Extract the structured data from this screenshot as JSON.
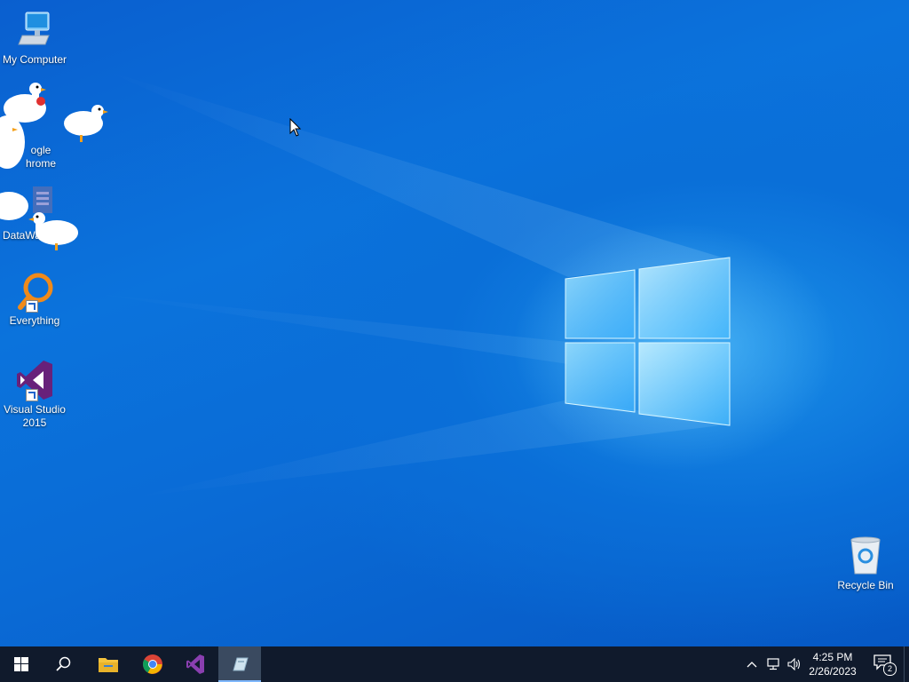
{
  "desktop": {
    "icons": [
      {
        "label": "My Computer"
      },
      {
        "label": "Google Chrome",
        "visible_label_part": "ogle",
        "visible_label_part2": "hrome"
      },
      {
        "label": "DataWa",
        "visible_label_part": "DataWa"
      },
      {
        "label": "Everything"
      },
      {
        "label": "Visual Studio 2015",
        "line1": "Visual Studio",
        "line2": "2015"
      },
      {
        "label": "Recycle Bin"
      }
    ]
  },
  "taskbar": {
    "items": [
      {
        "name": "start-button",
        "icon": "windows-logo-icon"
      },
      {
        "name": "search-button",
        "icon": "search-icon"
      },
      {
        "name": "file-explorer",
        "icon": "folder-icon"
      },
      {
        "name": "chrome",
        "icon": "chrome-icon"
      },
      {
        "name": "visual-studio",
        "icon": "visual-studio-icon"
      },
      {
        "name": "active-app",
        "icon": "app-icon"
      }
    ],
    "clock": {
      "time": "4:25 PM",
      "date": "2/26/2023"
    },
    "notifications": {
      "count": "2"
    }
  },
  "colors": {
    "taskbar": "#101a2c",
    "accent": "#0a6fd8"
  }
}
